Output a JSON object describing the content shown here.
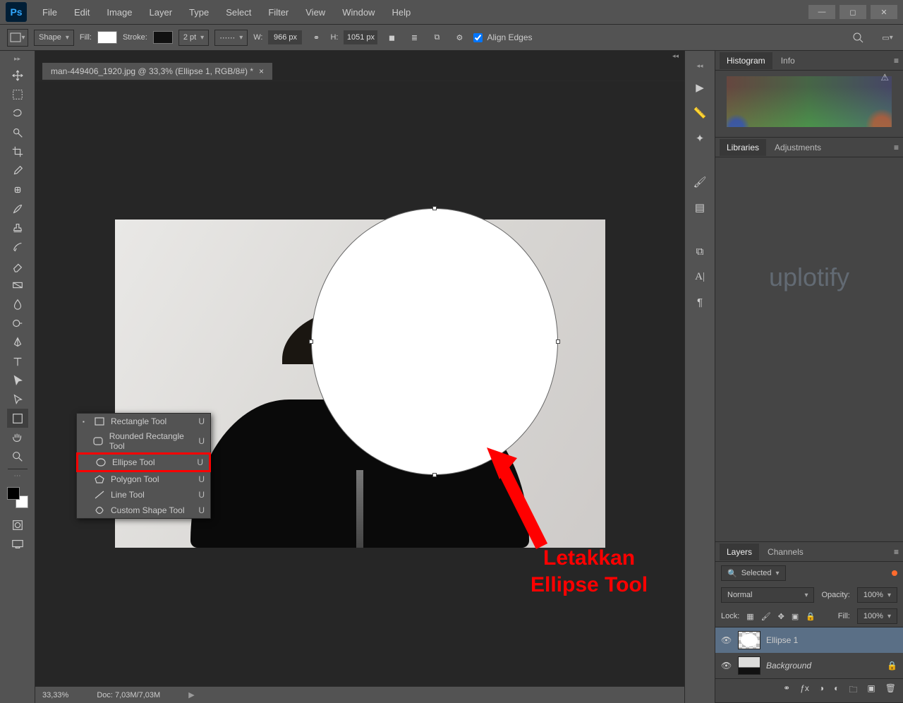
{
  "app": {
    "logo": "Ps"
  },
  "menu": [
    "File",
    "Edit",
    "Image",
    "Layer",
    "Type",
    "Select",
    "Filter",
    "View",
    "Window",
    "Help"
  ],
  "options": {
    "mode": "Shape",
    "fill_label": "Fill:",
    "stroke_label": "Stroke:",
    "stroke_width": "2 pt",
    "w_label": "W:",
    "w_value": "966 px",
    "h_label": "H:",
    "h_value": "1051 px",
    "align_edges": "Align Edges"
  },
  "document": {
    "tab_title": "man-449406_1920.jpg @ 33,3% (Ellipse 1, RGB/8#) *"
  },
  "shape_menu": {
    "items": [
      {
        "label": "Rectangle Tool",
        "key": "U"
      },
      {
        "label": "Rounded Rectangle Tool",
        "key": "U"
      },
      {
        "label": "Ellipse Tool",
        "key": "U"
      },
      {
        "label": "Polygon Tool",
        "key": "U"
      },
      {
        "label": "Line Tool",
        "key": "U"
      },
      {
        "label": "Custom Shape Tool",
        "key": "U"
      }
    ],
    "highlight_index": 2
  },
  "annotation": {
    "line1": "Letakkan",
    "line2": "Ellipse Tool"
  },
  "status": {
    "zoom": "33,33%",
    "doc_info": "Doc: 7,03M/7,03M"
  },
  "panels": {
    "hist_tabs": [
      "Histogram",
      "Info"
    ],
    "lib_tabs": [
      "Libraries",
      "Adjustments"
    ],
    "watermark": "uplotify",
    "layers_tabs": [
      "Layers",
      "Channels"
    ],
    "layers": {
      "filter_label": "Selected",
      "blend_mode": "Normal",
      "opacity_label": "Opacity:",
      "opacity_value": "100%",
      "lock_label": "Lock:",
      "fill_label": "Fill:",
      "fill_value": "100%",
      "rows": [
        {
          "name": "Ellipse 1",
          "selected": true
        },
        {
          "name": "Background",
          "locked": true,
          "italic": true
        }
      ]
    }
  }
}
